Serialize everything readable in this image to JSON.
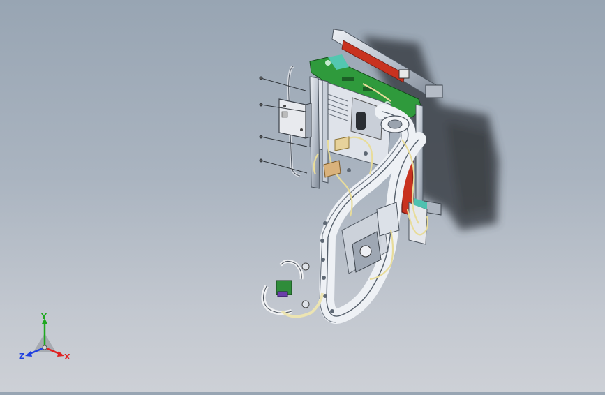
{
  "triad": {
    "y_label": "Y",
    "z_label": "Z",
    "x_label": "X",
    "colors": {
      "x": "#e02020",
      "y": "#1fa81f",
      "z": "#2040e0"
    }
  },
  "model": {
    "colors": {
      "frame": "#d6dbe3",
      "frame_dark": "#5b6470",
      "pcb_green": "#2f9a3c",
      "motor_red": "#c8321f",
      "wire_yellow": "#e8dc9a",
      "shadow": "#3a3f45",
      "connector_purple": "#6a3ea8"
    }
  }
}
